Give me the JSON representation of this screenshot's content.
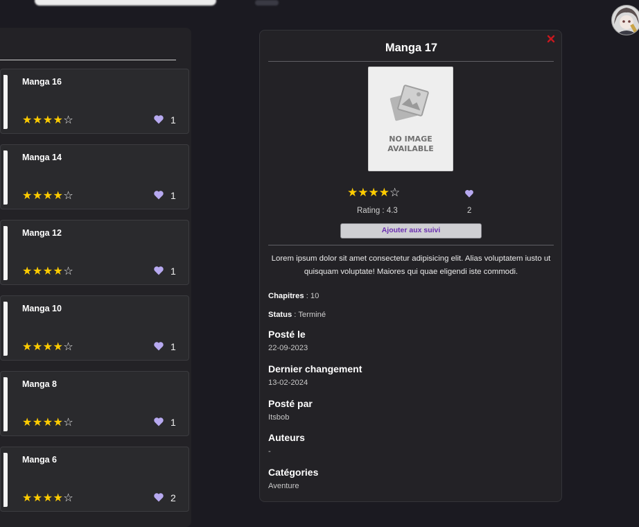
{
  "list": {
    "items": [
      {
        "title": "Manga 16",
        "likes": "1"
      },
      {
        "title": "Manga 14",
        "likes": "1"
      },
      {
        "title": "Manga 12",
        "likes": "1"
      },
      {
        "title": "Manga 10",
        "likes": "1"
      },
      {
        "title": "Manga 8",
        "likes": "1"
      },
      {
        "title": "Manga 6",
        "likes": "2"
      }
    ],
    "rating_stars": {
      "filled": 4,
      "total": 5
    }
  },
  "detail": {
    "title": "Manga 17",
    "close_label": "x",
    "cover": {
      "placeholder_line1": "NO IMAGE",
      "placeholder_line2": "AVAILABLE"
    },
    "rating_stars": {
      "filled": 4,
      "total": 5
    },
    "rating_text": "Rating : 4.3",
    "likes": "2",
    "follow_button": "Ajouter aux suivi",
    "description": "Lorem ipsum dolor sit amet consectetur adipisicing elit. Alias voluptatem iusto ut quisquam voluptate! Maiores qui quae eligendi iste commodi.",
    "chapters_label": "Chapitres",
    "chapters_value": " : 10",
    "status_label": "Status",
    "status_value": " : Terminé",
    "posted_on_label": "Posté le",
    "posted_on_value": "22-09-2023",
    "last_change_label": "Dernier changement",
    "last_change_value": "13-02-2024",
    "posted_by_label": "Posté par",
    "posted_by_value": "Itsbob",
    "authors_label": "Auteurs",
    "authors_value": "-",
    "categories_label": "Catégories",
    "categories_value": "Aventure"
  },
  "colors": {
    "background": "#1b1a21",
    "panel": "#232226",
    "card": "#2a2a2d",
    "star": "#ffcc00",
    "heart": "#b7a9f0",
    "follow_text": "#6a2fb0",
    "close": "#c8181e"
  },
  "icons": {
    "heart": "heart-icon",
    "close": "close-icon",
    "no_image": "image-placeholder-icon",
    "avatar": "user-avatar"
  }
}
